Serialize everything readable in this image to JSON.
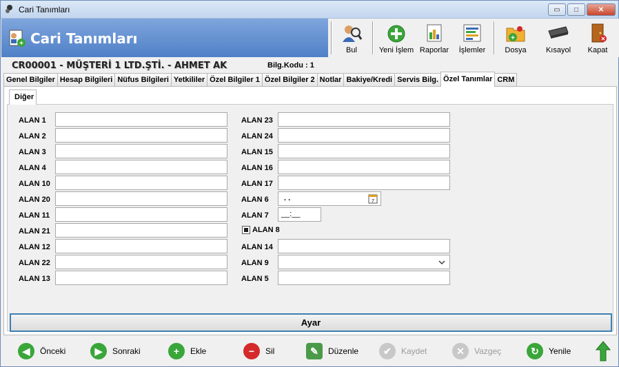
{
  "window": {
    "title": "Cari Tanımları",
    "minimize": "▭",
    "maximize": "□",
    "close": "✕"
  },
  "header": {
    "title": "Cari Tanımları"
  },
  "toolbar": [
    {
      "label": "Bul",
      "icon": "search-person-icon"
    },
    {
      "label": "Yeni İşlem",
      "icon": "add-icon"
    },
    {
      "label": "Raporlar",
      "icon": "report-icon"
    },
    {
      "label": "İşlemler",
      "icon": "operations-icon"
    },
    {
      "label": "Dosya",
      "icon": "folder-icon"
    },
    {
      "label": "Kısayol",
      "icon": "keyboard-icon"
    },
    {
      "label": "Kapat",
      "icon": "exit-door-icon"
    }
  ],
  "info": {
    "code": "CR00001  -  MÜŞTERİ 1 LTD.ŞTİ.  -  AHMET   AK",
    "bilg": "Bilg.Kodu : 1"
  },
  "tabs": [
    "Genel Bilgiler",
    "Hesap Bilgileri",
    "Nüfus Bilgileri",
    "Yetkililer",
    "Özel Bilgiler 1",
    "Özel Bilgiler 2",
    "Notlar",
    "Bakiye/Kredi",
    "Servis Bilg.",
    "Özel Tanımlar",
    "CRM"
  ],
  "active_tab": "Özel Tanımlar",
  "subtab": "Diğer",
  "left_fields": [
    "ALAN 1",
    "ALAN 2",
    "ALAN 3",
    "ALAN 4",
    "ALAN 10",
    "ALAN 20",
    "ALAN 11",
    "ALAN 21",
    "ALAN 12",
    "ALAN 22",
    "ALAN 13"
  ],
  "right_fields": {
    "f23": "ALAN 23",
    "f24": "ALAN 24",
    "f15": "ALAN 15",
    "f16": "ALAN 16",
    "f17": "ALAN 17",
    "f6": "ALAN 6",
    "f6_value": ". .",
    "f7": "ALAN 7",
    "f7_value": "__:__",
    "f8": "ALAN 8",
    "f14": "ALAN 14",
    "f9": "ALAN 9",
    "f5": "ALAN 5"
  },
  "ayar_button": "Ayar",
  "bottom": [
    {
      "label": "Önceki",
      "color": "#3aa63a",
      "glyph": "◀",
      "disabled": false
    },
    {
      "label": "Sonraki",
      "color": "#3aa63a",
      "glyph": "▶",
      "disabled": false
    },
    {
      "label": "Ekle",
      "color": "#3aa63a",
      "glyph": "+",
      "disabled": false
    },
    {
      "label": "Sil",
      "color": "#d42a2a",
      "glyph": "−",
      "disabled": false
    },
    {
      "label": "Düzenle",
      "color": "#4a9a4a",
      "glyph": "✎",
      "disabled": false
    },
    {
      "label": "Kaydet",
      "color": "#c8c8c8",
      "glyph": "✔",
      "disabled": true
    },
    {
      "label": "Vazgeç",
      "color": "#c8c8c8",
      "glyph": "✕",
      "disabled": true
    },
    {
      "label": "Yenile",
      "color": "#3aa63a",
      "glyph": "↻",
      "disabled": false
    }
  ],
  "colors": {
    "brand": "#5f8dd0",
    "accent": "#3c7fb1"
  }
}
